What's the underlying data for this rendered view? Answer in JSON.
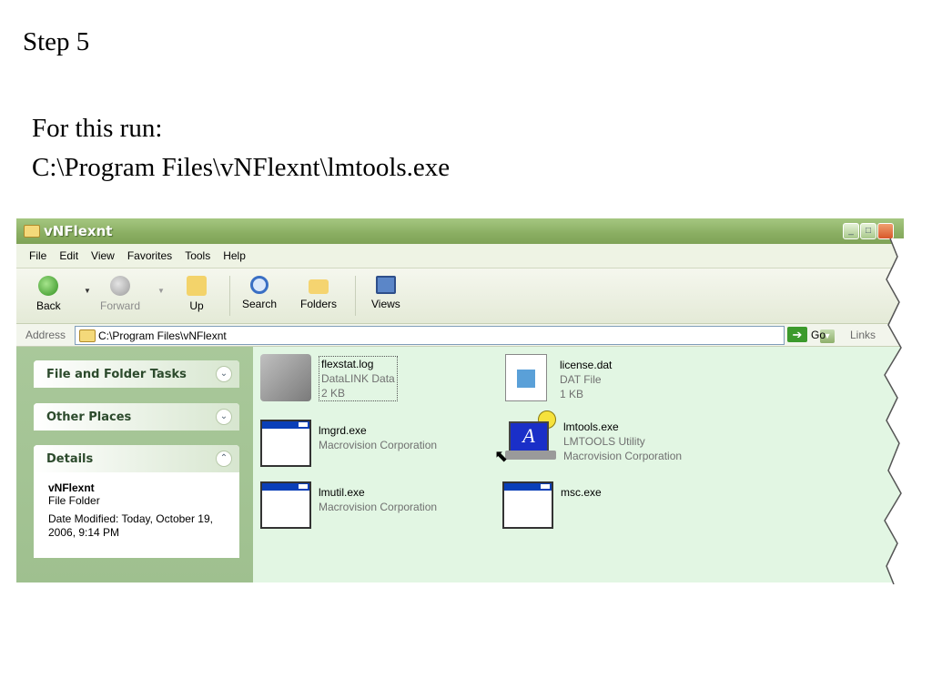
{
  "slide": {
    "step": "Step 5",
    "line1": "For this run:",
    "line2": "C:\\Program Files\\vNFlexnt\\lmtools.exe"
  },
  "window": {
    "title": "vNFlexnt",
    "menu": [
      "File",
      "Edit",
      "View",
      "Favorites",
      "Tools",
      "Help"
    ],
    "toolbar": {
      "back": "Back",
      "forward": "Forward",
      "up": "Up",
      "search": "Search",
      "folders": "Folders",
      "views": "Views"
    },
    "address": {
      "label": "Address",
      "value": "C:\\Program Files\\vNFlexnt",
      "go": "Go",
      "links": "Links"
    },
    "sidebar": {
      "file_tasks": "File and Folder Tasks",
      "other_places": "Other Places",
      "details": "Details",
      "details_name": "vNFlexnt",
      "details_type": "File Folder",
      "details_modified": "Date Modified: Today, October 19, 2006, 9:14 PM"
    },
    "files": [
      {
        "name": "flexstat.log",
        "line2": "DataLINK Data",
        "line3": "2 KB",
        "icon": "datalink-icon"
      },
      {
        "name": "license.dat",
        "line2": "DAT File",
        "line3": "1 KB",
        "icon": "dat-file-icon"
      },
      {
        "name": "lmgrd.exe",
        "line2": "Macrovision Corporation",
        "line3": "",
        "icon": "exe-window-icon"
      },
      {
        "name": "lmtools.exe",
        "line2": "LMTOOLS Utility",
        "line3": "Macrovision Corporation",
        "icon": "lmtools-icon"
      },
      {
        "name": "lmutil.exe",
        "line2": "Macrovision Corporation",
        "line3": "",
        "icon": "exe-window-icon"
      },
      {
        "name": "msc.exe",
        "line2": "",
        "line3": "",
        "icon": "exe-window-icon"
      }
    ]
  }
}
